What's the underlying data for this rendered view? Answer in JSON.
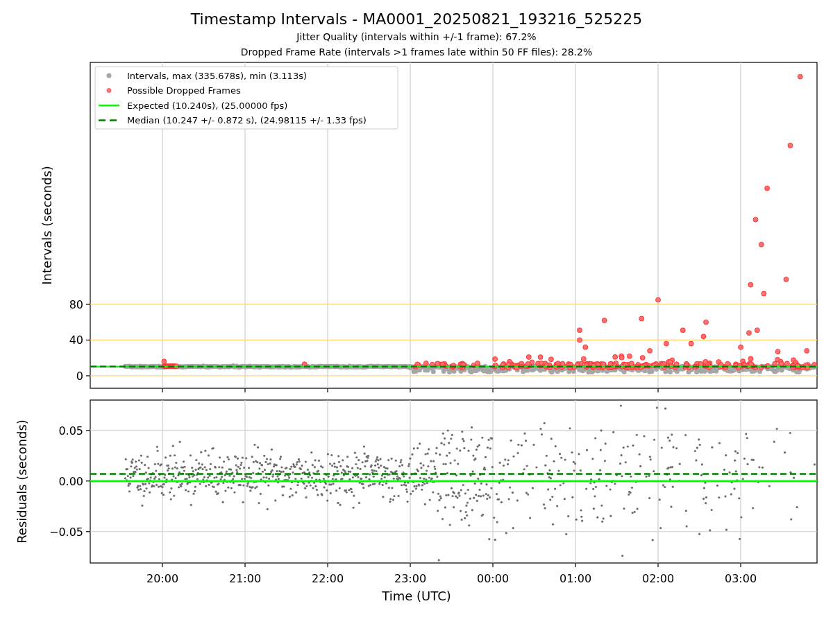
{
  "figure": {
    "title": "Timestamp Intervals - MA0001_20250821_193216_525225",
    "subtitles": [
      "Jitter Quality (intervals within +/-1 frame): 67.2%",
      "Dropped Frame Rate (intervals >1 frames late within 50 FF files): 28.2%"
    ]
  },
  "panels": [
    {
      "axes": {
        "ylabel": "Intervals (seconds)",
        "yticks": [
          "80",
          "40",
          "0"
        ]
      },
      "legend": [
        {
          "kind": "marker",
          "label": "Intervals, max (335.678s), min (3.113s)",
          "color": "#a6a6a6"
        },
        {
          "kind": "marker",
          "label": "Possible Dropped Frames",
          "color": "#ff7070"
        },
        {
          "kind": "solid",
          "label": "Expected (10.240s), (25.00000 fps)",
          "color": "#00ff00"
        },
        {
          "kind": "dashed",
          "label": "Median (10.247 +/- 0.872 s), (24.98115 +/- 1.33 fps)",
          "color": "#008000"
        }
      ]
    },
    {
      "axes": {
        "ylabel": "Residuals (seconds)",
        "xlabel": "Time (UTC)",
        "yticks": [
          "0.05",
          "0.00",
          "−0.05"
        ],
        "xticks": [
          "20:00",
          "21:00",
          "22:00",
          "23:00",
          "00:00",
          "01:00",
          "02:00",
          "03:00"
        ]
      }
    }
  ]
}
